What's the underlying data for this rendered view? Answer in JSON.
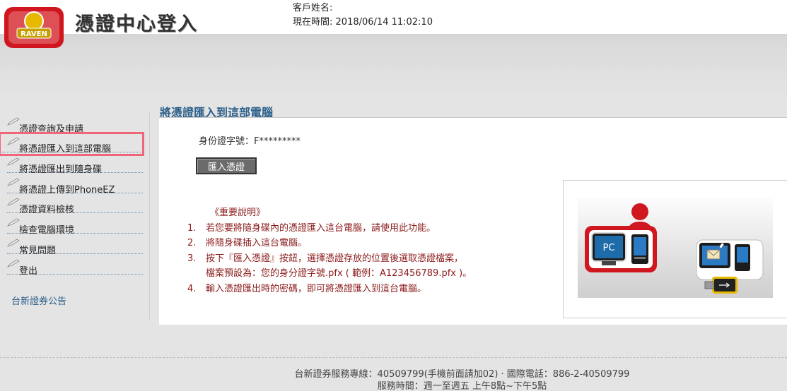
{
  "header": {
    "logo_badge_text": "RAVEN",
    "title": "憑證中心登入",
    "customer_label": "客戶姓名:",
    "customer_value": "",
    "time_label": "現在時間:",
    "time_value": "2018/06/14 11:02:10"
  },
  "sidebar": {
    "items": [
      {
        "label": "憑證查詢及申請"
      },
      {
        "label": "將憑證匯入到這部電腦"
      },
      {
        "label": "將憑證匯出到隨身碟"
      },
      {
        "label": "將憑證上傳到PhoneEZ"
      },
      {
        "label": "憑證資料檢核"
      },
      {
        "label": "檢查電腦環境"
      },
      {
        "label": "常見問題"
      },
      {
        "label": "登出"
      }
    ],
    "active_index": 1,
    "news_label": "台新證券公告"
  },
  "main": {
    "section_title": "將憑證匯入到這部電腦",
    "id_label": "身份證字號：",
    "id_value": "F*********",
    "import_button": "匯入憑證",
    "notes_title": "《重要說明》",
    "notes": [
      {
        "num": "1.",
        "text": "若您要將隨身碟內的憑證匯入這台電腦，請使用此功能。"
      },
      {
        "num": "2.",
        "text": "將隨身碟插入這台電腦。"
      },
      {
        "num": "3.",
        "text": "按下『匯入憑證』按鈕，選擇憑證存放的位置後選取憑證檔案，",
        "cont": "檔案預設為：您的身分證字號.pfx ( 範例：A123456789.pfx )。"
      },
      {
        "num": "4.",
        "text": "輸入憑證匯出時的密碼，即可將憑證匯入到這台電腦。"
      }
    ],
    "illustration": {
      "pc_label": "PC"
    }
  },
  "footer": {
    "line1": "台新證券服務專線：40509799(手機前面請加02) · 國際電話：886-2-40509799",
    "line2": "服務時間：週一至週五 上午8點~下午5點"
  },
  "colors": {
    "accent_blue": "#2b5f8a",
    "note_red": "#8b1a1a",
    "highlight": "#f0657a",
    "brand_red": "#d0161e"
  },
  "icons": {
    "sidebar_bullet": "pen-icon",
    "device_icons": [
      "user-icon",
      "pc-icon",
      "mail-icon",
      "usb-icon"
    ]
  }
}
